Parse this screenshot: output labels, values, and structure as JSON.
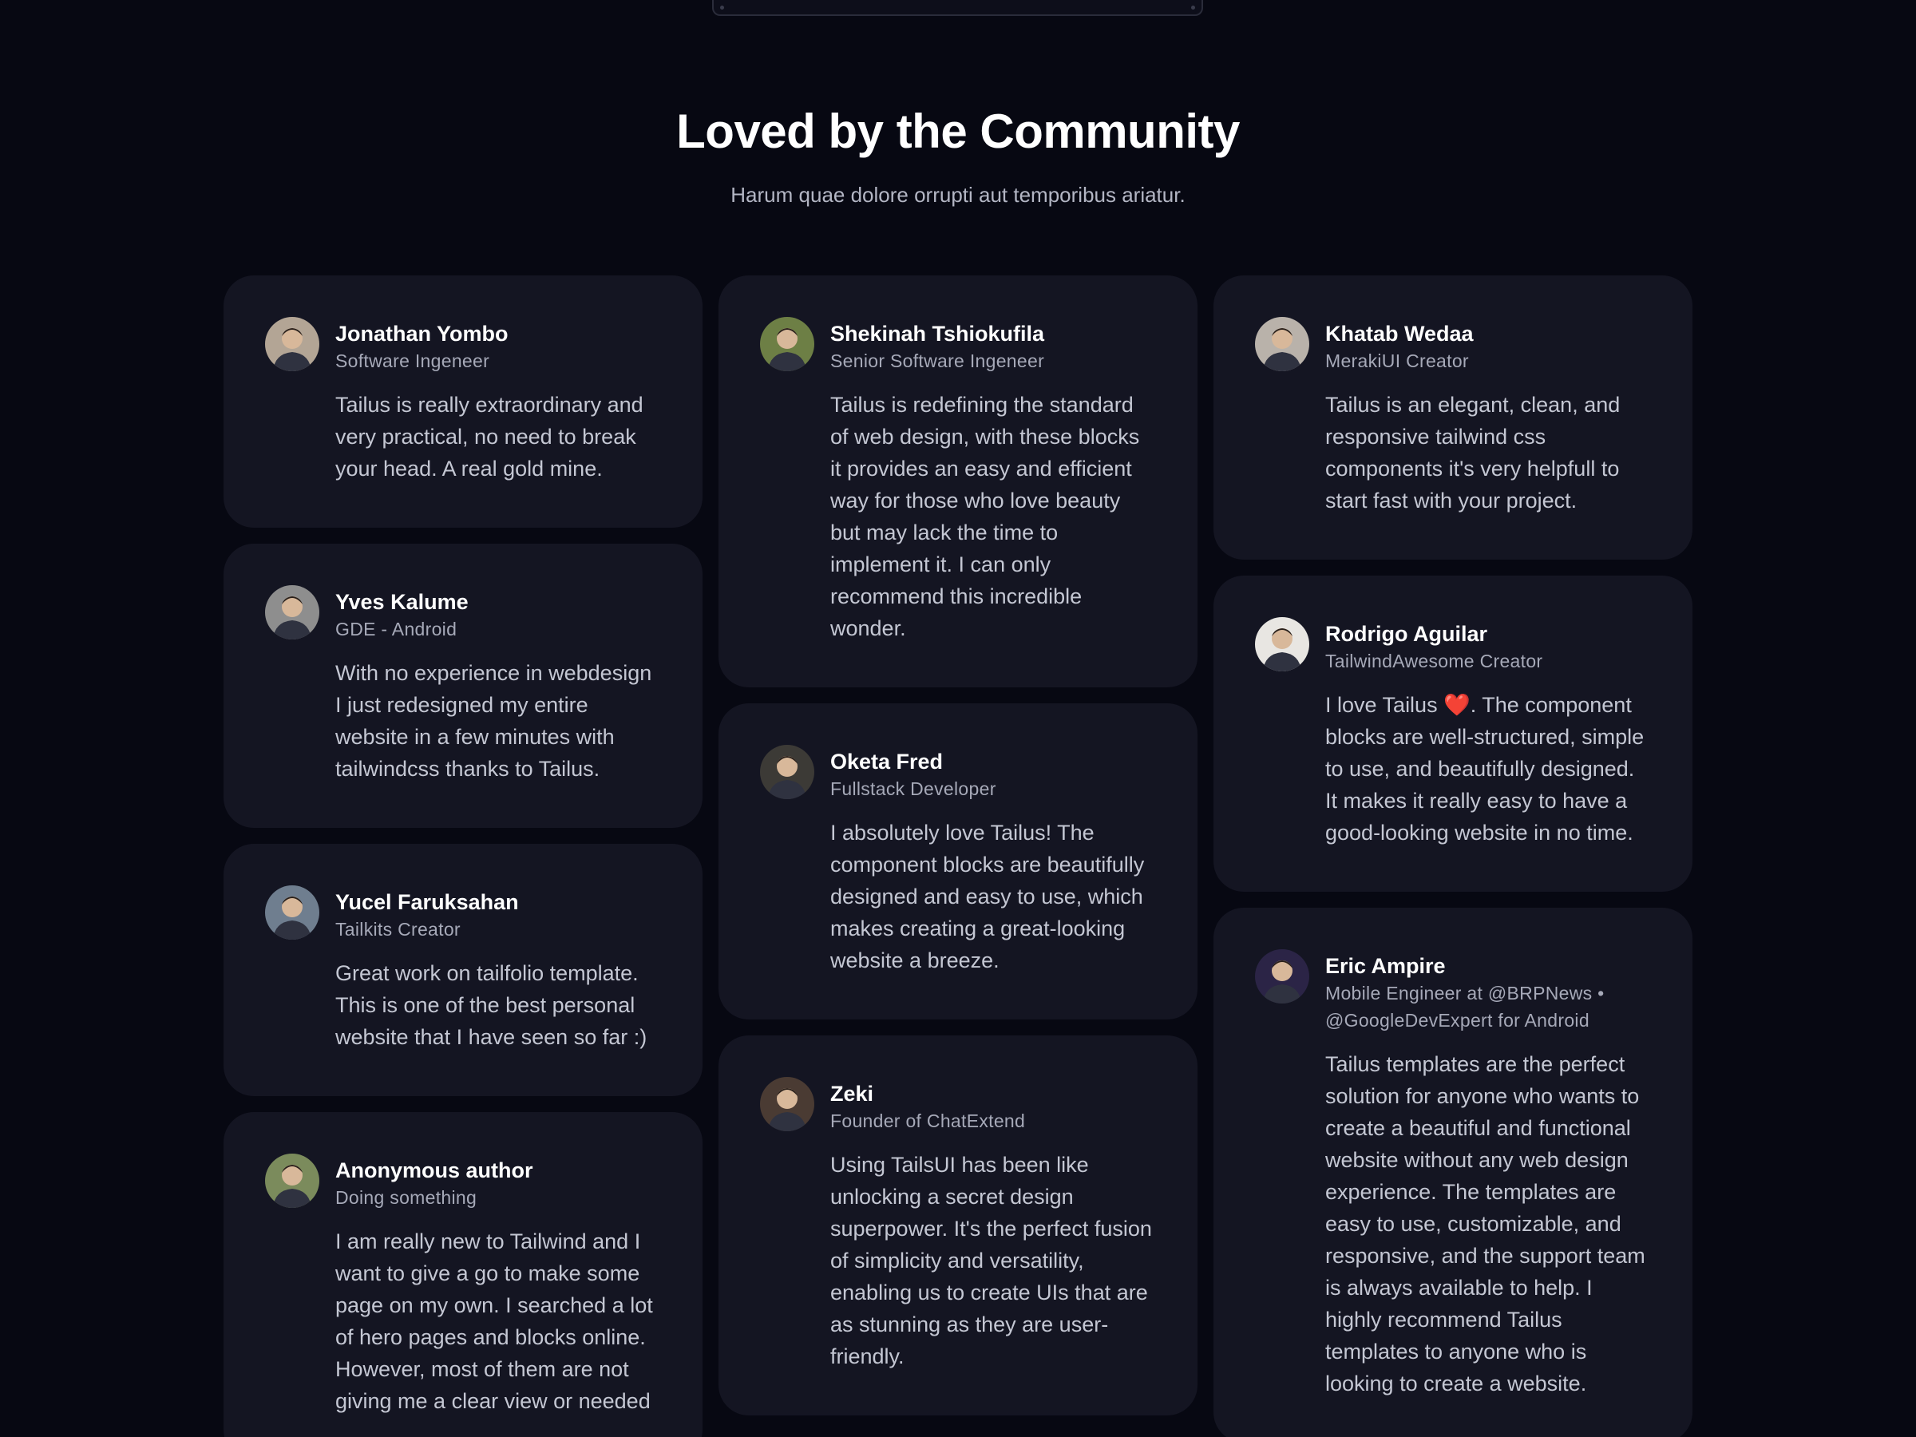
{
  "section": {
    "title": "Loved by the Community",
    "subtitle": "Harum quae dolore orrupti aut temporibus ariatur."
  },
  "columns": [
    [
      {
        "name": "Jonathan Yombo",
        "role": "Software Ingeneer",
        "quote": "Tailus is really extraordinary and very practical, no need to break your head. A real gold mine.",
        "avatar": "#b3a595"
      },
      {
        "name": "Yves Kalume",
        "role": "GDE - Android",
        "quote": "With no experience in webdesign I just redesigned my entire website in a few minutes with tailwindcss thanks to Tailus.",
        "avatar": "#8e8e8e"
      },
      {
        "name": "Yucel Faruksahan",
        "role": "Tailkits Creator",
        "quote": "Great work on tailfolio template. This is one of the best personal website that I have seen so far :)",
        "avatar": "#6f7e8f"
      },
      {
        "name": "Anonymous author",
        "role": "Doing something",
        "quote": "I am really new to Tailwind and I want to give a go to make some page on my own. I searched a lot of hero pages and blocks online. However, most of them are not giving me a clear view or needed",
        "avatar": "#7b8b5c"
      }
    ],
    [
      {
        "name": "Shekinah Tshiokufila",
        "role": "Senior Software Ingeneer",
        "quote": "Tailus is redefining the standard of web design, with these blocks it provides an easy and efficient way for those who love beauty but may lack the time to implement it. I can only recommend this incredible wonder.",
        "avatar": "#6d7f45"
      },
      {
        "name": "Oketa Fred",
        "role": "Fullstack Developer",
        "quote": "I absolutely love Tailus! The component blocks are beautifully designed and easy to use, which makes creating a great-looking website a breeze.",
        "avatar": "#3c3a36"
      },
      {
        "name": "Zeki",
        "role": "Founder of ChatExtend",
        "quote": "Using TailsUI has been like unlocking a secret design superpower. It's the perfect fusion of simplicity and versatility, enabling us to create UIs that are as stunning as they are user-friendly.",
        "avatar": "#4a3b33"
      }
    ],
    [
      {
        "name": "Khatab Wedaa",
        "role": "MerakiUI Creator",
        "quote": "Tailus is an elegant, clean, and responsive tailwind css components it's very helpfull to start fast with your project.",
        "avatar": "#b9b2aa"
      },
      {
        "name": "Rodrigo Aguilar",
        "role": "TailwindAwesome Creator",
        "quote": "I love Tailus ❤️. The component blocks are well-structured, simple to use, and beautifully designed. It makes it really easy to have a good-looking website in no time.",
        "avatar": "#e8e6e2"
      },
      {
        "name": "Eric Ampire",
        "role": "Mobile Engineer at @BRPNews • @GoogleDevExpert for Android",
        "quote": "Tailus templates are the perfect solution for anyone who wants to create a beautiful and functional website without any web design experience. The templates are easy to use, customizable, and responsive, and the support team is always available to help. I highly recommend Tailus templates to anyone who is looking to create a website.",
        "avatar": "#2b2446"
      }
    ]
  ]
}
